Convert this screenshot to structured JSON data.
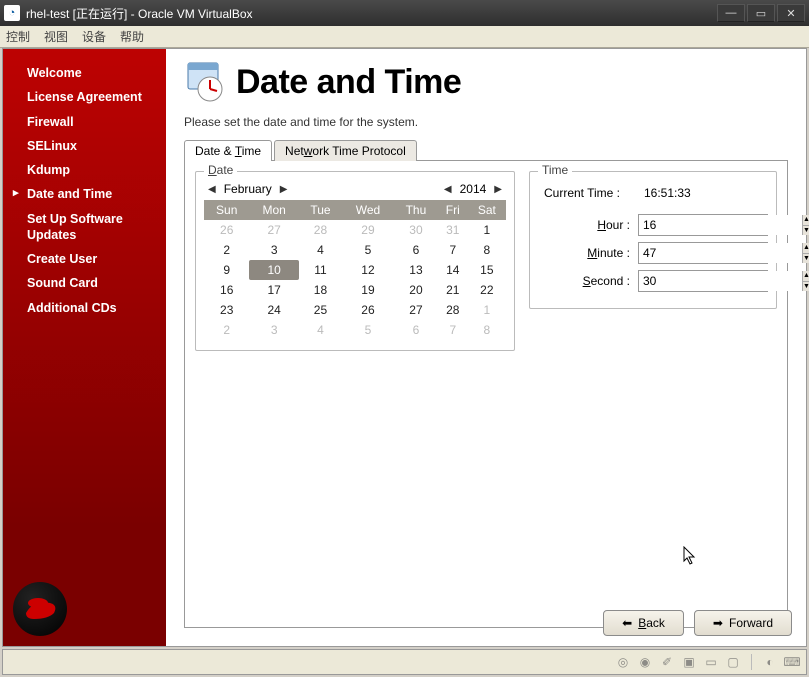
{
  "window": {
    "title": "rhel-test [正在运行] - Oracle VM VirtualBox"
  },
  "vm_menu": [
    "控制",
    "视图",
    "设备",
    "帮助"
  ],
  "sidebar": {
    "items": [
      {
        "label": "Welcome"
      },
      {
        "label": "License Agreement"
      },
      {
        "label": "Firewall"
      },
      {
        "label": "SELinux"
      },
      {
        "label": "Kdump"
      },
      {
        "label": "Date and Time",
        "active": true
      },
      {
        "label": "Set Up Software Updates"
      },
      {
        "label": "Create User"
      },
      {
        "label": "Sound Card"
      },
      {
        "label": "Additional CDs"
      }
    ]
  },
  "page": {
    "title": "Date and Time",
    "description": "Please set the date and time for the system."
  },
  "tabs": {
    "date_time": "Date & Time",
    "ntp": "Network Time Protocol"
  },
  "date_panel": {
    "legend": "Date",
    "month": "February",
    "year": "2014",
    "weekdays": [
      "Sun",
      "Mon",
      "Tue",
      "Wed",
      "Thu",
      "Fri",
      "Sat"
    ],
    "grid": [
      [
        {
          "v": "26",
          "dim": true
        },
        {
          "v": "27",
          "dim": true
        },
        {
          "v": "28",
          "dim": true
        },
        {
          "v": "29",
          "dim": true
        },
        {
          "v": "30",
          "dim": true
        },
        {
          "v": "31",
          "dim": true
        },
        {
          "v": "1"
        }
      ],
      [
        {
          "v": "2"
        },
        {
          "v": "3"
        },
        {
          "v": "4"
        },
        {
          "v": "5"
        },
        {
          "v": "6"
        },
        {
          "v": "7"
        },
        {
          "v": "8"
        }
      ],
      [
        {
          "v": "9"
        },
        {
          "v": "10",
          "sel": true
        },
        {
          "v": "11"
        },
        {
          "v": "12"
        },
        {
          "v": "13"
        },
        {
          "v": "14"
        },
        {
          "v": "15"
        }
      ],
      [
        {
          "v": "16"
        },
        {
          "v": "17"
        },
        {
          "v": "18"
        },
        {
          "v": "19"
        },
        {
          "v": "20"
        },
        {
          "v": "21"
        },
        {
          "v": "22"
        }
      ],
      [
        {
          "v": "23"
        },
        {
          "v": "24"
        },
        {
          "v": "25"
        },
        {
          "v": "26"
        },
        {
          "v": "27"
        },
        {
          "v": "28"
        },
        {
          "v": "1",
          "dim": true
        }
      ],
      [
        {
          "v": "2",
          "dim": true
        },
        {
          "v": "3",
          "dim": true
        },
        {
          "v": "4",
          "dim": true
        },
        {
          "v": "5",
          "dim": true
        },
        {
          "v": "6",
          "dim": true
        },
        {
          "v": "7",
          "dim": true
        },
        {
          "v": "8",
          "dim": true
        }
      ]
    ]
  },
  "time_panel": {
    "legend": "Time",
    "current_label": "Current Time :",
    "current_value": "16:51:33",
    "hour_label": "Hour :",
    "hour_value": "16",
    "minute_label": "Minute :",
    "minute_value": "47",
    "second_label": "Second :",
    "second_value": "30"
  },
  "buttons": {
    "back": "Back",
    "forward": "Forward"
  }
}
